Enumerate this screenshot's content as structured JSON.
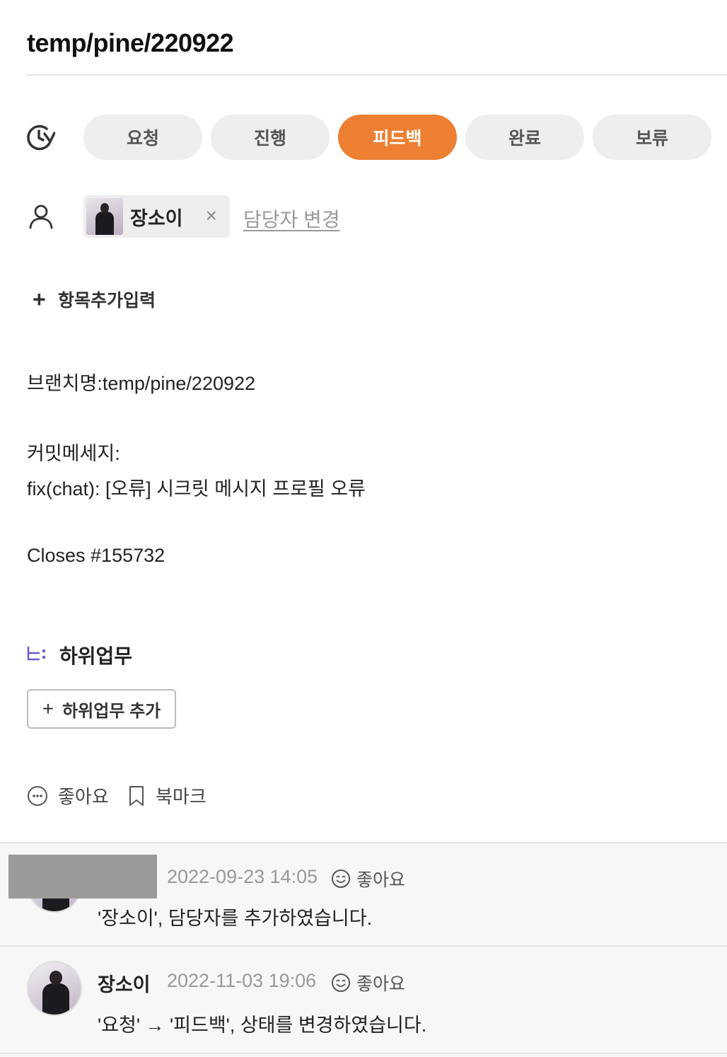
{
  "task": {
    "title": "temp/pine/220922"
  },
  "status": {
    "icon": "status-history-icon",
    "options": [
      "요청",
      "진행",
      "피드백",
      "완료",
      "보류"
    ],
    "selected": "피드백",
    "accent_color": "#ec7f32"
  },
  "assignee": {
    "icon": "person-icon",
    "name": "장소이",
    "remove_label": "×",
    "change_label": "담당자 변경"
  },
  "add_field": {
    "plus": "+",
    "label": "항목추가입력"
  },
  "description": {
    "lines": [
      "브랜치명:temp/pine/220922",
      "커밋메세지:",
      "fix(chat): [오류] 시크릿 메시지 프로필 오류",
      "Closes #155732"
    ]
  },
  "subtasks": {
    "icon": "subtask-icon",
    "title": "하위업무",
    "add_plus": "+",
    "add_label": "하위업무 추가"
  },
  "reactions": {
    "like_label": "좋아요",
    "bookmark_label": "북마크"
  },
  "comments": [
    {
      "author": "",
      "time": "2022-09-23 14:05",
      "like_label": "좋아요",
      "text": "'장소이', 담당자를 추가하였습니다."
    },
    {
      "author": "장소이",
      "time": "2022-11-03 19:06",
      "like_label": "좋아요",
      "text": "'요청' → '피드백', 상태를 변경하였습니다."
    }
  ]
}
